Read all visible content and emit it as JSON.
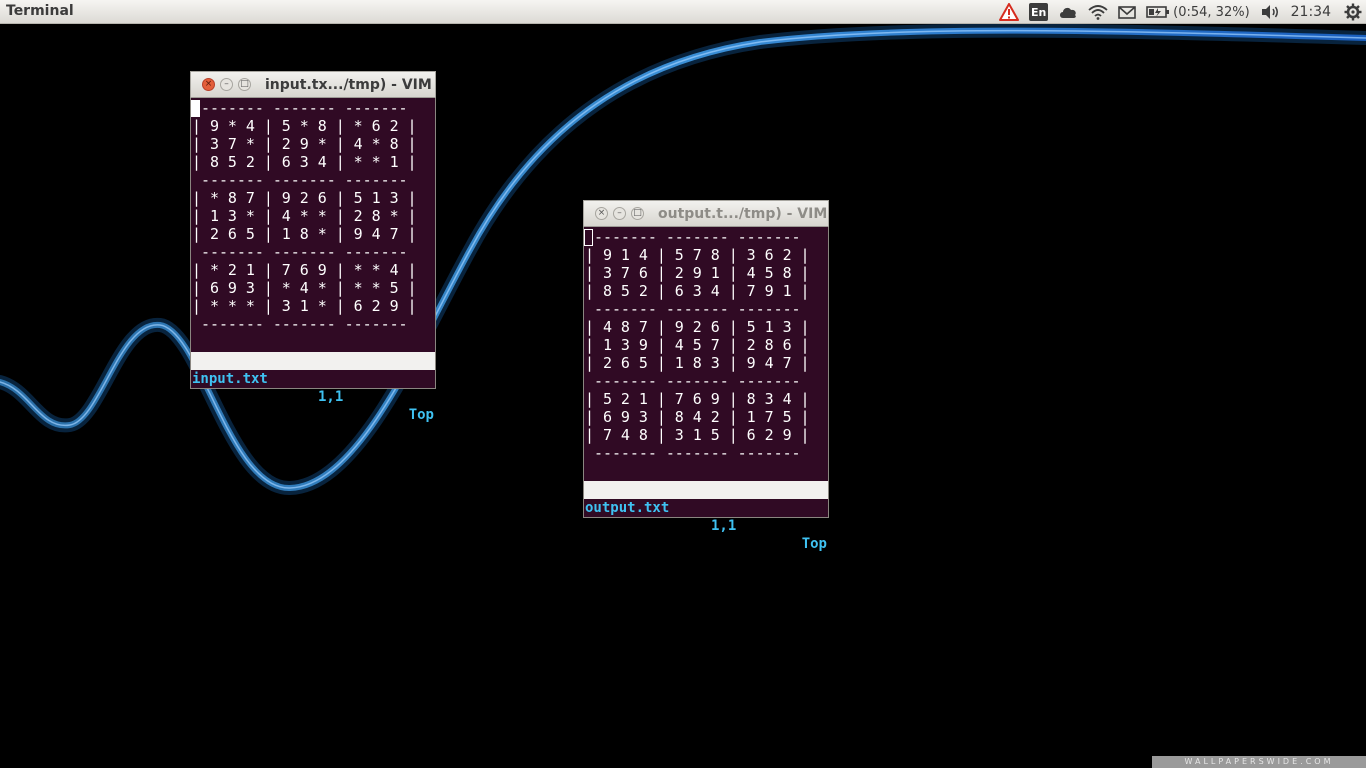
{
  "panel": {
    "app_title": "Terminal",
    "keyboard_layout": "En",
    "battery_text": "(0:54, 32%)",
    "clock": "21:34"
  },
  "icons": {
    "alert": "alert-triangle-icon",
    "cloud": "cloud-icon",
    "wifi": "wifi-icon",
    "mail": "mail-icon",
    "battery": "battery-charging-icon",
    "volume": "volume-icon",
    "session": "gear-icon"
  },
  "colors": {
    "terminal_bg": "#300a24",
    "text": "#ffffff",
    "statusline_fg": "#3fc2f2",
    "close_button": "#e35e3a"
  },
  "input_window": {
    "title": "input.tx.../tmp) - VIM",
    "lines": [
      " ------- ------- -------",
      "| 9 * 4 | 5 * 8 | * 6 2 |",
      "| 3 7 * | 2 9 * | 4 * 8 |",
      "| 8 5 2 | 6 3 4 | * * 1 |",
      " ------- ------- -------",
      "| * 8 7 | 9 2 6 | 5 1 3 |",
      "| 1 3 * | 4 * * | 2 8 * |",
      "| 2 6 5 | 1 8 * | 9 4 7 |",
      " ------- ------- -------",
      "| * 2 1 | 7 6 9 | * * 4 |",
      "| 6 9 3 | * 4 * | * * 5 |",
      "| * * * | 3 1 * | 6 2 9 |",
      " ------- ------- -------"
    ],
    "status": {
      "file": "input.txt",
      "position": "1,1",
      "scroll": "Top"
    }
  },
  "output_window": {
    "title": "output.t.../tmp) - VIM",
    "lines": [
      " ------- ------- -------",
      "| 9 1 4 | 5 7 8 | 3 6 2 |",
      "| 3 7 6 | 2 9 1 | 4 5 8 |",
      "| 8 5 2 | 6 3 4 | 7 9 1 |",
      " ------- ------- -------",
      "| 4 8 7 | 9 2 6 | 5 1 3 |",
      "| 1 3 9 | 4 5 7 | 2 8 6 |",
      "| 2 6 5 | 1 8 3 | 9 4 7 |",
      " ------- ------- -------",
      "| 5 2 1 | 7 6 9 | 8 3 4 |",
      "| 6 9 3 | 8 4 2 | 1 7 5 |",
      "| 7 4 8 | 3 1 5 | 6 2 9 |",
      " ------- ------- -------"
    ],
    "status": {
      "file": "output.txt",
      "position": "1,1",
      "scroll": "Top"
    }
  },
  "watermark": "WALLPAPERSWIDE.COM"
}
